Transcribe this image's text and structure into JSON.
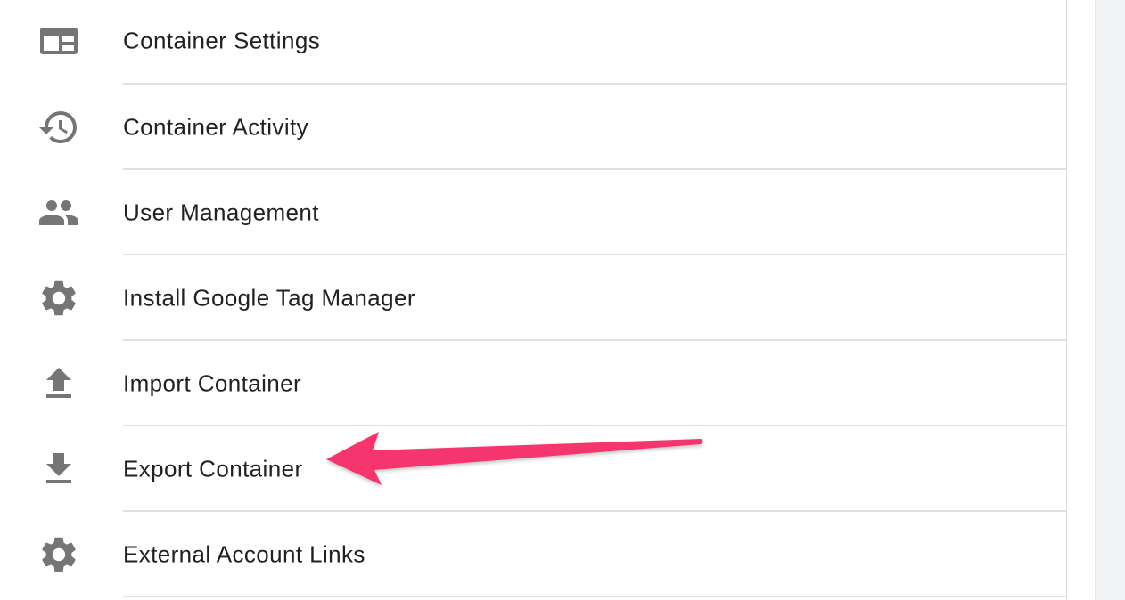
{
  "menu": {
    "items": [
      {
        "label": "Container Settings",
        "icon": "container-settings-icon"
      },
      {
        "label": "Container Activity",
        "icon": "history-icon"
      },
      {
        "label": "User Management",
        "icon": "people-icon"
      },
      {
        "label": "Install Google Tag Manager",
        "icon": "gear-icon"
      },
      {
        "label": "Import Container",
        "icon": "upload-icon"
      },
      {
        "label": "Export Container",
        "icon": "download-icon"
      },
      {
        "label": "External Account Links",
        "icon": "gear-icon"
      }
    ]
  },
  "annotation": {
    "arrow_color": "#f5356e",
    "target": "Export Container"
  },
  "colors": {
    "icon": "#757575",
    "text": "#212121",
    "divider": "#e0e0e0"
  }
}
